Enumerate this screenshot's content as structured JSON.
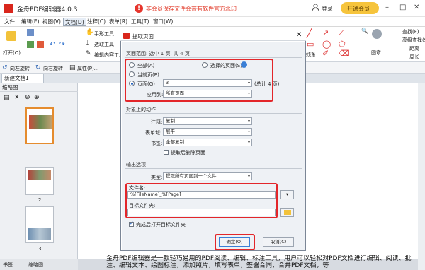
{
  "app": {
    "title": "金舟PDF编辑器4.0.3",
    "warning": "非会员保存文件会带有软件官方水印",
    "login": "登录",
    "vip": "开通会员"
  },
  "menu": [
    "文件",
    "编辑(E)",
    "视图(V)",
    "文档(D)",
    "注释(C)",
    "表单(R)",
    "工具(T)",
    "窗口(W)"
  ],
  "ribbon": {
    "open": "打开(O)...",
    "hand": "手形工具",
    "select": "选取工具",
    "edit_content": "编辑内容工具",
    "lines": "线条",
    "stamp": "图章",
    "find": "查找(F)",
    "adv_search": "高级查找(S)",
    "distance": "距离",
    "perimeter": "周长",
    "area": "面积"
  },
  "subtoolbar": {
    "rotate_left": "向左旋转",
    "rotate_right": "向右旋转",
    "properties": "属性(P)..."
  },
  "tab": {
    "doc": "新建文档1"
  },
  "thumbnails": {
    "header": "缩略图",
    "pages": [
      "1",
      "2",
      "3"
    ]
  },
  "bottom_tabs": [
    "书签",
    "缩略图"
  ],
  "doc_text": "金舟PDF编辑器是一款轻巧易用的PDF阅读、编辑、标注工具，用户可以轻松对PDF文档进行编辑、阅读、批注、编辑文本、绘图标注，添加照片，填写表单，签署合同，合并PDF文档，等",
  "dialog": {
    "title": "提取页面",
    "range": {
      "group": "页面范围: 选中 1 页, 共 4 页",
      "all": "全部(A)",
      "current": "当前页(E)",
      "pages": "页面(G)",
      "pages_value": "3",
      "selected_pages": "选择的页面(S)",
      "total": "(总计 4 页)",
      "apply_to": "应用到:",
      "apply_value": "所有页面"
    },
    "actions": {
      "group": "对象上的动作",
      "annotation": "注释:",
      "annotation_value": "复制",
      "form_fields": "表单域:",
      "form_value": "展平",
      "bookmarks": "书签:",
      "bookmarks_value": "全部复制",
      "delete_after": "提取后删除页面"
    },
    "output": {
      "group": "输出选项",
      "type": "类型:",
      "type_value": "提取所有页面到一个文件",
      "filename_label": "文件名:",
      "filename_value": "%[FileName]_%[Page]",
      "folder_label": "目标文件夹:",
      "open_after": "完成后打开目标文件夹"
    },
    "ok": "确定(O)",
    "cancel": "取消(C)"
  }
}
